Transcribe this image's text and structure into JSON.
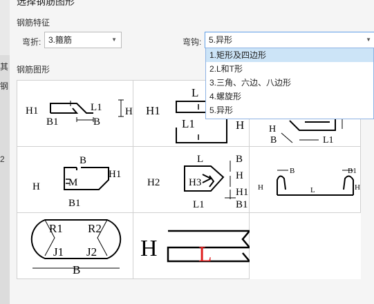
{
  "dialog": {
    "title": "选择钢筋图形",
    "features_section": "钢筋特征",
    "shapes_section": "钢筋图形",
    "bend_label": "弯折:",
    "bend_value": "3.箍筋",
    "hook_label": "弯钩:",
    "hook_value": "5.异形"
  },
  "background_window": {
    "chars": [
      "其",
      "钢",
      "2"
    ]
  },
  "hook_options": [
    "1.矩形及四边形",
    "2.L和T形",
    "3.三角、六边、八边形",
    "4.螺旋形",
    "5.异形"
  ],
  "hook_selected_index": 0,
  "shapes": [
    {
      "labels": [
        "H1",
        "L1",
        "H",
        "B1",
        "B"
      ]
    },
    {
      "labels": [
        "L",
        "H1",
        "L1",
        "H"
      ]
    },
    {
      "labels": [
        "H",
        "B",
        "L1"
      ]
    },
    {
      "labels": [
        "B",
        "H1",
        "H",
        "M",
        "B1"
      ]
    },
    {
      "labels": [
        "L",
        "B",
        "H",
        "H2",
        "H3",
        "H1",
        "L1",
        "B1"
      ]
    },
    {
      "labels": [
        "B",
        "B1",
        "H",
        "L",
        "H1"
      ]
    },
    {
      "labels": [
        "R1",
        "R2",
        "J1",
        "J2",
        "B"
      ]
    },
    {
      "labels": [
        "H",
        "L"
      ]
    }
  ],
  "colors": {
    "selection": "#cce4f7",
    "highlight_border": "#5c9ce6",
    "accent_text": "#e02020"
  }
}
